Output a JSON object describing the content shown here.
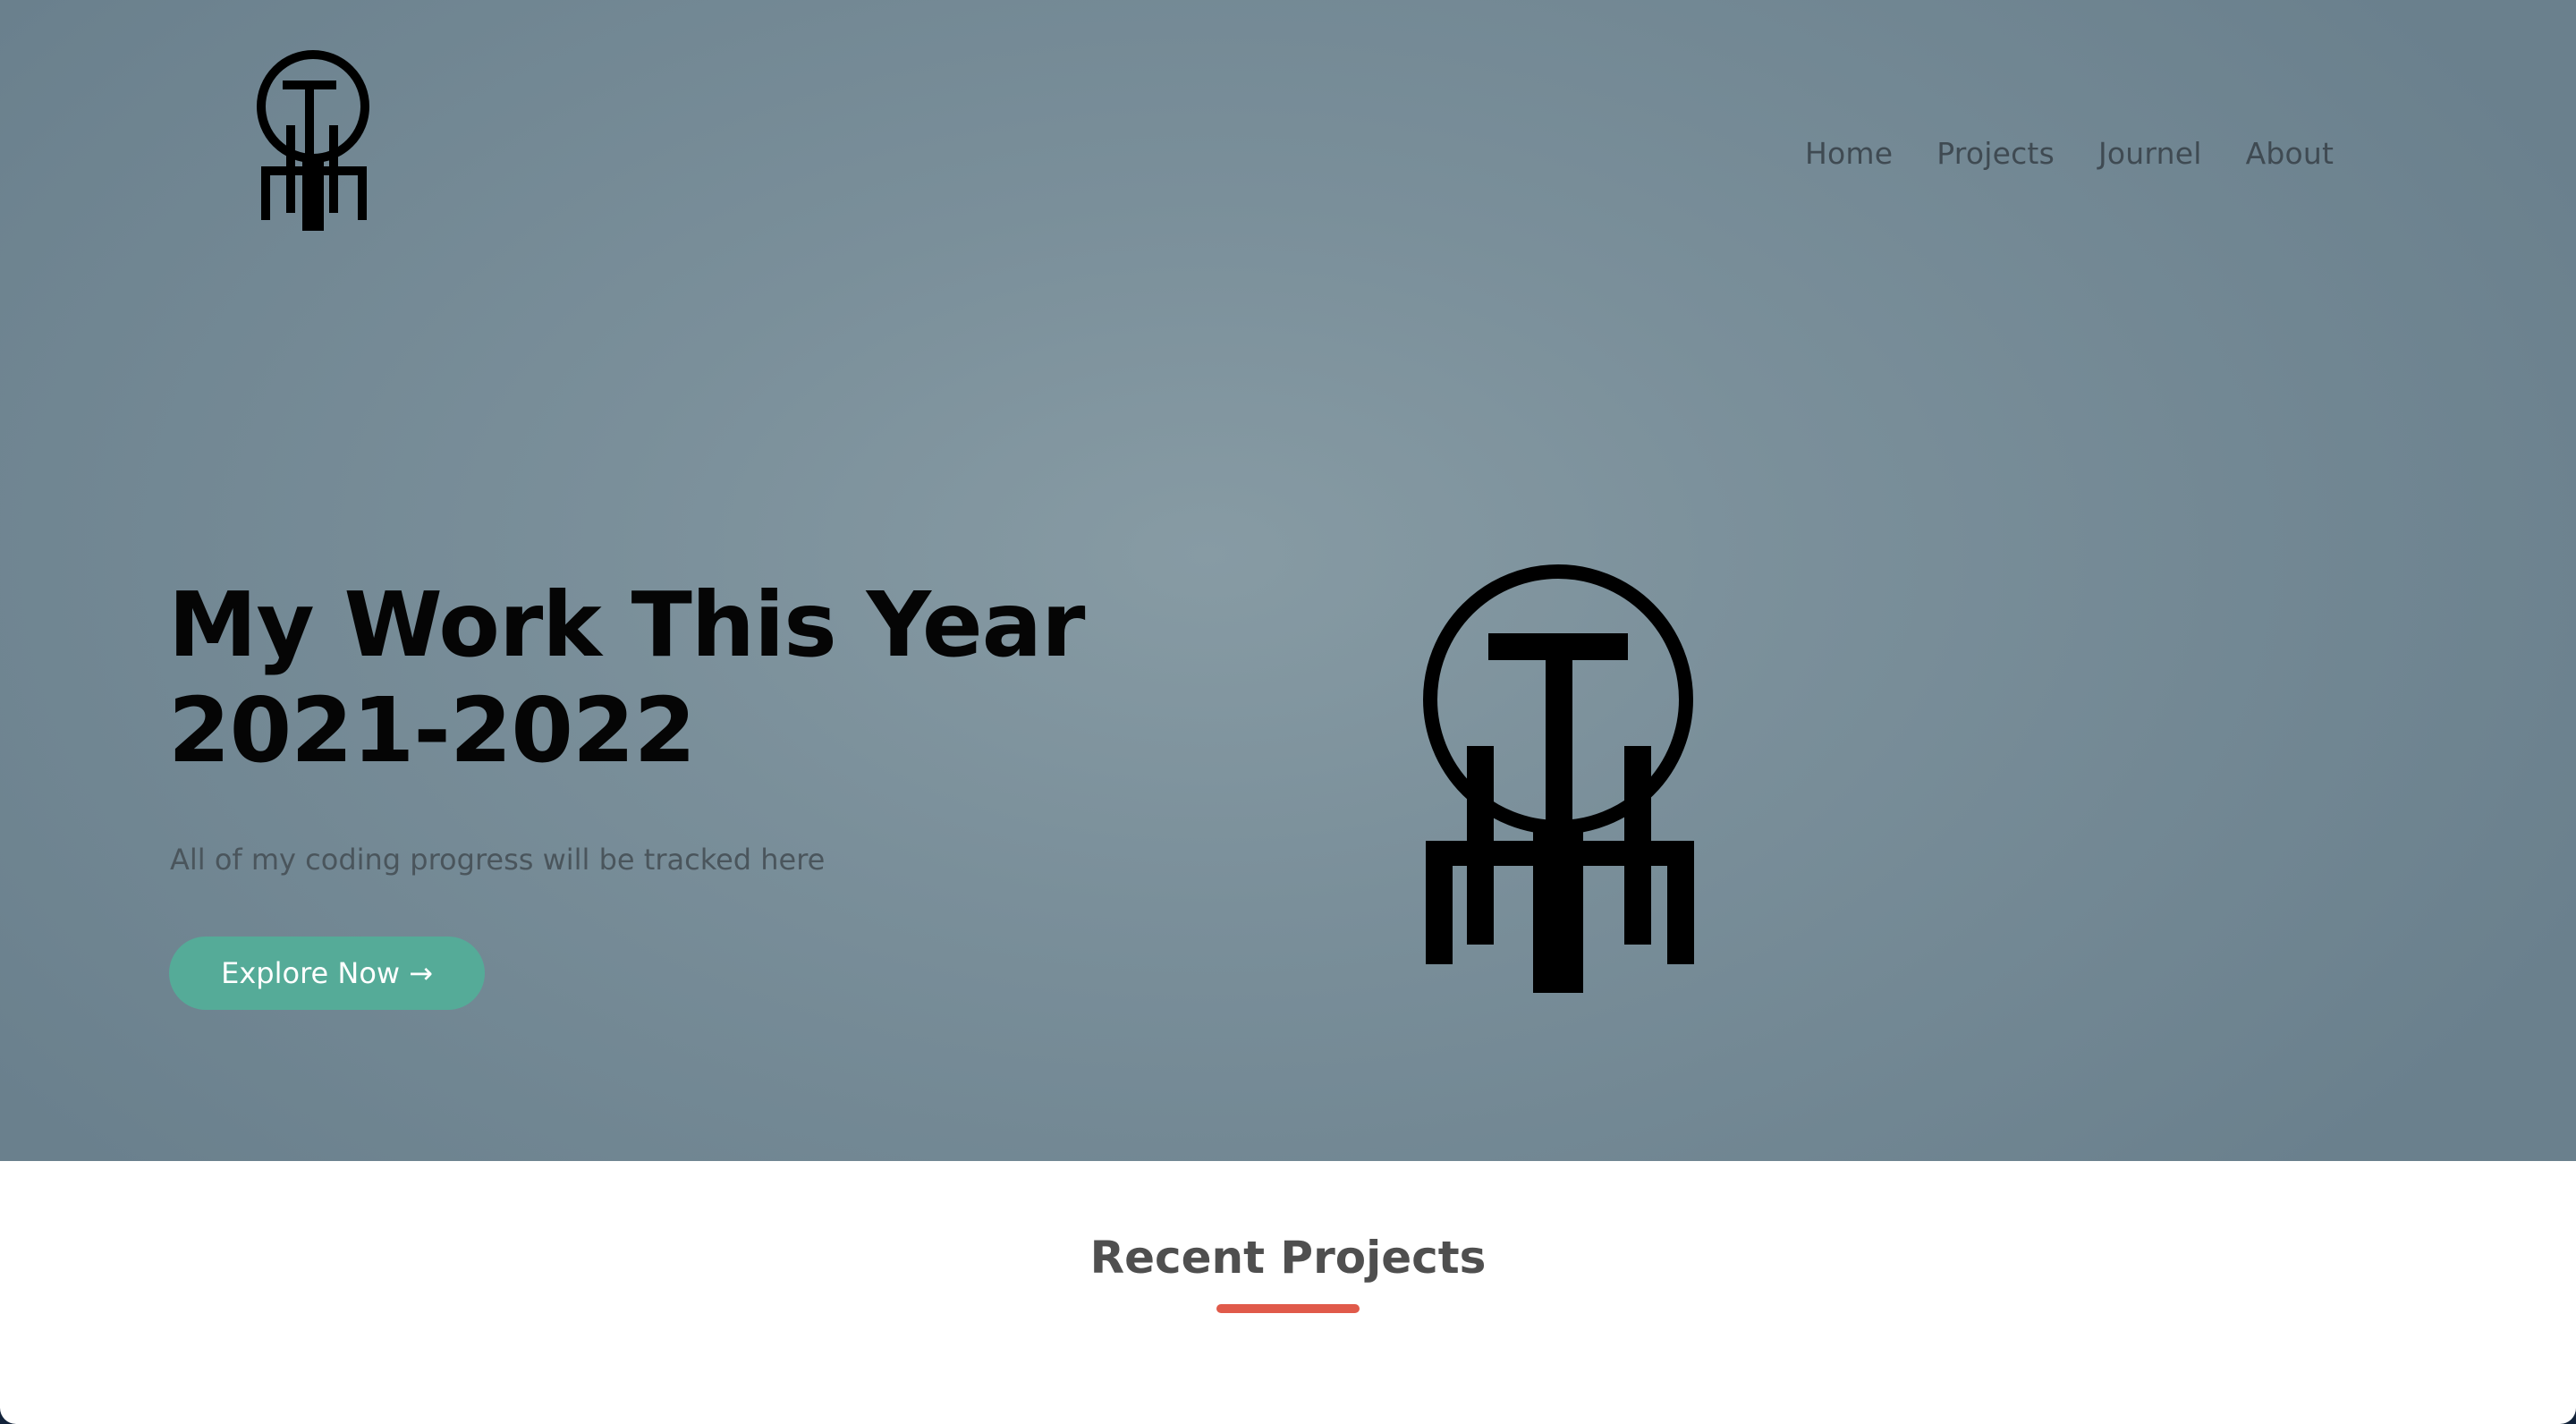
{
  "nav": {
    "items": [
      "Home",
      "Projects",
      "Journel",
      "About"
    ]
  },
  "hero": {
    "title_line1": "My Work This Year",
    "title_line2": "2021-2022",
    "subtitle": "All of my coding progress will be tracked here",
    "cta_label": "Explore Now",
    "cta_arrow": "→"
  },
  "section": {
    "title": "Recent Projects"
  },
  "colors": {
    "hero_bg": "#7a8f9a",
    "cta_bg": "#55ab98",
    "accent_underline": "#e05a4a",
    "nav_text": "#3f4a52"
  },
  "icons": {
    "logo": "tm-monogram-logo",
    "hero_graphic": "tm-monogram-logo"
  }
}
